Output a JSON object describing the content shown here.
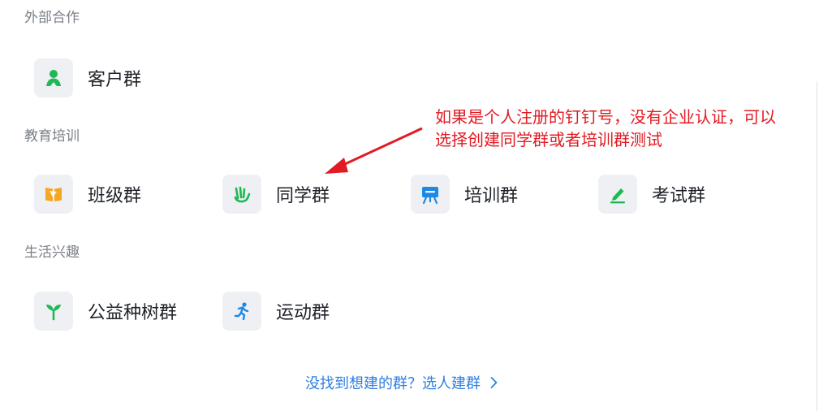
{
  "sections": {
    "external": {
      "title": "外部合作",
      "items": [
        {
          "label": "客户群",
          "icon": "customer-group-icon"
        }
      ]
    },
    "education": {
      "title": "教育培训",
      "items": [
        {
          "label": "班级群",
          "icon": "class-book-icon"
        },
        {
          "label": "同学群",
          "icon": "classmate-hand-icon"
        },
        {
          "label": "培训群",
          "icon": "training-board-icon"
        },
        {
          "label": "考试群",
          "icon": "exam-pen-icon"
        }
      ]
    },
    "life": {
      "title": "生活兴趣",
      "items": [
        {
          "label": "公益种树群",
          "icon": "sprout-icon"
        },
        {
          "label": "运动群",
          "icon": "runner-icon"
        }
      ]
    }
  },
  "annotation": {
    "line1": "如果是个人注册的钉钉号，没有企业认证，可以",
    "line2": "选择创建同学群或者培训群测试"
  },
  "footer": {
    "link_text": "没找到想建的群？选人建群"
  },
  "colors": {
    "icon_green": "#1db954",
    "icon_orange": "#f5a623",
    "icon_blue": "#1e88e5",
    "annotation_red": "#e11b23",
    "link_blue": "#2f7fe0"
  }
}
